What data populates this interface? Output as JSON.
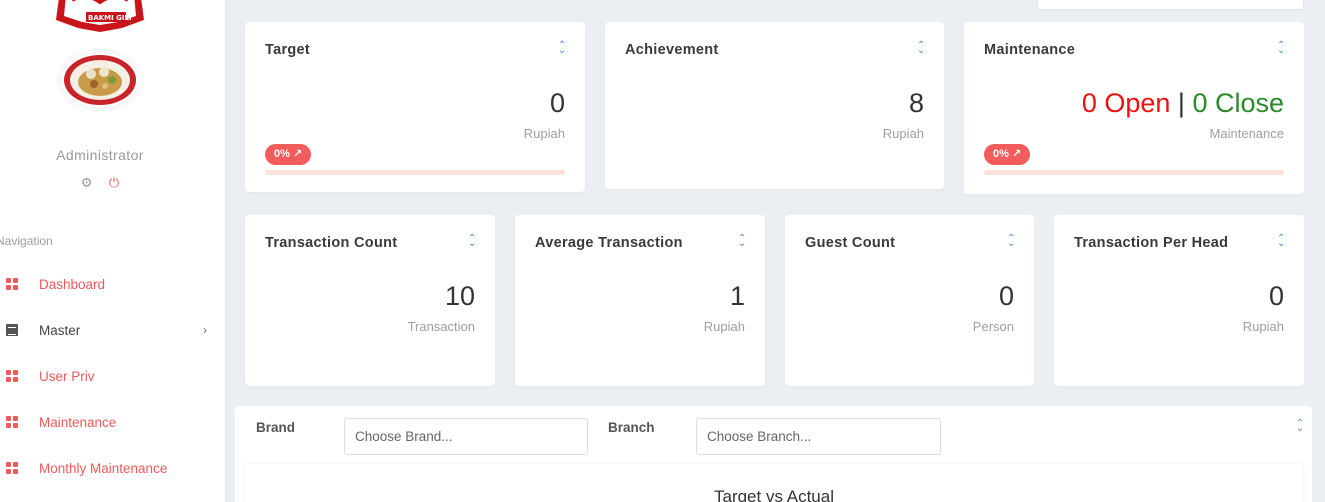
{
  "sidebar": {
    "logo_text": "BAKMI GILI",
    "user_name": "Administrator",
    "nav_title": "Navigation",
    "items": [
      {
        "label": "Dashboard",
        "icon": "grid-icon"
      },
      {
        "label": "Master",
        "icon": "list-icon"
      },
      {
        "label": "User Priv",
        "icon": "grid-icon"
      },
      {
        "label": "Maintenance",
        "icon": "grid-icon"
      },
      {
        "label": "Monthly Maintenance",
        "icon": "grid-icon"
      }
    ]
  },
  "cards": {
    "target": {
      "title": "Target",
      "value": "0",
      "unit": "Rupiah",
      "badge": "0%",
      "progress_pct": 0
    },
    "achievement": {
      "title": "Achievement",
      "value": "8",
      "unit": "Rupiah"
    },
    "maintenance": {
      "title": "Maintenance",
      "open": "0 Open",
      "sep": "|",
      "close": "0 Close",
      "unit": "Maintenance",
      "badge": "0%",
      "progress_pct": 0
    },
    "transaction_count": {
      "title": "Transaction Count",
      "value": "10",
      "unit": "Transaction"
    },
    "average_transaction": {
      "title": "Average Transaction",
      "value": "1",
      "unit": "Rupiah"
    },
    "guest_count": {
      "title": "Guest Count",
      "value": "0",
      "unit": "Person"
    },
    "transaction_per_head": {
      "title": "Transaction Per Head",
      "value": "0",
      "unit": "Rupiah"
    }
  },
  "filter": {
    "brand_label": "Brand",
    "brand_placeholder": "Choose Brand...",
    "branch_label": "Branch",
    "branch_placeholder": "Choose Branch..."
  },
  "chart": {
    "title": "Target vs Actual"
  },
  "colors": {
    "accent": "#f05a5a",
    "open": "#e11111",
    "close": "#2a8a2a"
  }
}
